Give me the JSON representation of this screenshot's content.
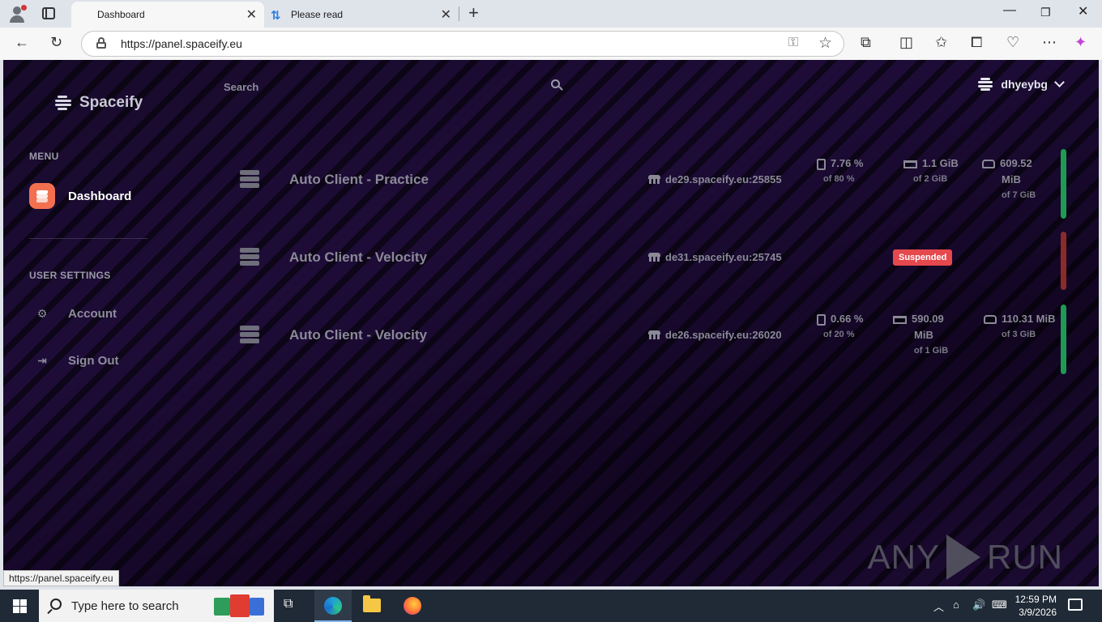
{
  "browser": {
    "tabs": [
      {
        "label": "Dashboard",
        "active": true
      },
      {
        "label": "Please read",
        "active": false
      }
    ],
    "address": "https://panel.spaceify.eu",
    "status_link": "https://panel.spaceify.eu"
  },
  "app": {
    "brand": "Spaceify",
    "search_placeholder": "Search",
    "user": "dhyeybg"
  },
  "sidebar": {
    "menu_heading": "MENU",
    "menu_items": [
      {
        "label": "Dashboard",
        "icon": "layers-icon",
        "active": true
      }
    ],
    "settings_heading": "USER SETTINGS",
    "settings_items": [
      {
        "label": "Account",
        "icon": "cogs-icon"
      },
      {
        "label": "Sign Out",
        "icon": "sign-out-icon"
      }
    ]
  },
  "servers": [
    {
      "name": "Auto Client - Practice",
      "address": "de29.spaceify.eu:25855",
      "cpu": "7.76 %",
      "cpu_limit": "of 80 %",
      "ram_value": "1.1 GiB",
      "ram_limit": "of 2 GiB",
      "disk_value": "609.52",
      "disk_unit": "MiB",
      "disk_limit": "of 7 GiB",
      "status_color": "#1e9a55"
    },
    {
      "name": "Auto Client - Velocity",
      "address": "de31.spaceify.eu:25745",
      "status_badge": "Suspended",
      "status_color": "#8c2a2a"
    },
    {
      "name": "Auto Client - Velocity",
      "address": "de26.spaceify.eu:26020",
      "cpu": "0.66 %",
      "cpu_limit": "of 20 %",
      "ram_value": "590.09",
      "ram_unit": "MiB",
      "ram_limit": "of 1 GiB",
      "disk_value": "110.31 MiB",
      "disk_limit": "of 3 GiB",
      "status_color": "#1e9a55"
    }
  ],
  "watermark": {
    "left": "ANY",
    "right": "RUN"
  },
  "taskbar": {
    "search_text": "Type here to search",
    "time": "12:59 PM",
    "date": "3/9/2026"
  }
}
